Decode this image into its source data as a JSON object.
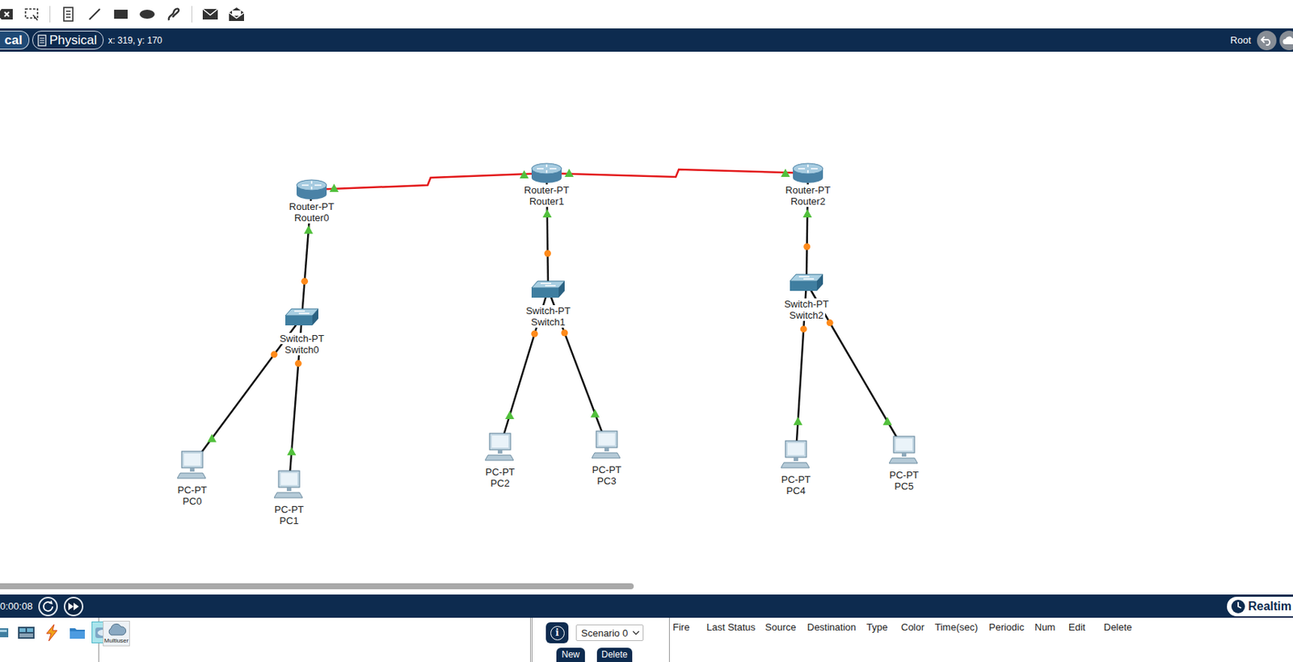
{
  "view_bar": {
    "tabs": [
      {
        "label": "cal",
        "selected": false
      },
      {
        "label": "Physical",
        "selected": true
      }
    ],
    "coordinates": "x: 319, y: 170",
    "location": "Root"
  },
  "nodes": [
    {
      "model": "Router-PT",
      "name": "Router0",
      "kind": "router"
    },
    {
      "model": "Router-PT",
      "name": "Router1",
      "kind": "router"
    },
    {
      "model": "Router-PT",
      "name": "Router2",
      "kind": "router"
    },
    {
      "model": "Switch-PT",
      "name": "Switch0",
      "kind": "switch"
    },
    {
      "model": "Switch-PT",
      "name": "Switch1",
      "kind": "switch"
    },
    {
      "model": "Switch-PT",
      "name": "Switch2",
      "kind": "switch"
    },
    {
      "model": "PC-PT",
      "name": "PC0",
      "kind": "pc"
    },
    {
      "model": "PC-PT",
      "name": "PC1",
      "kind": "pc"
    },
    {
      "model": "PC-PT",
      "name": "PC2",
      "kind": "pc"
    },
    {
      "model": "PC-PT",
      "name": "PC3",
      "kind": "pc"
    },
    {
      "model": "PC-PT",
      "name": "PC4",
      "kind": "pc"
    },
    {
      "model": "PC-PT",
      "name": "PC5",
      "kind": "pc"
    }
  ],
  "links": [
    {
      "from": "Router0",
      "to": "Router1",
      "kind": "serial",
      "from_status": "up",
      "to_status": "up"
    },
    {
      "from": "Router1",
      "to": "Router2",
      "kind": "serial",
      "from_status": "up",
      "to_status": "up"
    },
    {
      "from": "Router0",
      "to": "Switch0",
      "kind": "ethernet",
      "from_status": "up",
      "to_status": "amber"
    },
    {
      "from": "Router1",
      "to": "Switch1",
      "kind": "ethernet",
      "from_status": "up",
      "to_status": "amber"
    },
    {
      "from": "Router2",
      "to": "Switch2",
      "kind": "ethernet",
      "from_status": "up",
      "to_status": "amber"
    },
    {
      "from": "Switch0",
      "to": "PC0",
      "kind": "ethernet",
      "from_status": "amber",
      "to_status": "up"
    },
    {
      "from": "Switch0",
      "to": "PC1",
      "kind": "ethernet",
      "from_status": "amber",
      "to_status": "up"
    },
    {
      "from": "Switch1",
      "to": "PC2",
      "kind": "ethernet",
      "from_status": "amber",
      "to_status": "up"
    },
    {
      "from": "Switch1",
      "to": "PC3",
      "kind": "ethernet",
      "from_status": "amber",
      "to_status": "up"
    },
    {
      "from": "Switch2",
      "to": "PC4",
      "kind": "ethernet",
      "from_status": "amber",
      "to_status": "up"
    },
    {
      "from": "Switch2",
      "to": "PC5",
      "kind": "ethernet",
      "from_status": "amber",
      "to_status": "up"
    }
  ],
  "horizontal_scroll": {
    "level": 0.49
  },
  "simulation_bar": {
    "time": "0:00:08",
    "mode": "Realtim"
  },
  "device_panel": {
    "categories": [
      {
        "kind": "component",
        "selected": false
      },
      {
        "kind": "board",
        "selected": false
      },
      {
        "kind": "connections",
        "selected": false
      },
      {
        "kind": "folder",
        "selected": false
      },
      {
        "kind": "multiuser",
        "selected": true
      }
    ],
    "devices": [
      {
        "label": "Multiuser"
      }
    ]
  },
  "scenario": {
    "info": "i",
    "selected": "Scenario 0",
    "buttons": [
      "New",
      "Delete"
    ]
  },
  "pdu_table": {
    "columns": [
      "Fire",
      "Last Status",
      "Source",
      "Destination",
      "Type",
      "Color",
      "Time(sec)",
      "Periodic",
      "Num",
      "Edit",
      "Delete"
    ]
  }
}
